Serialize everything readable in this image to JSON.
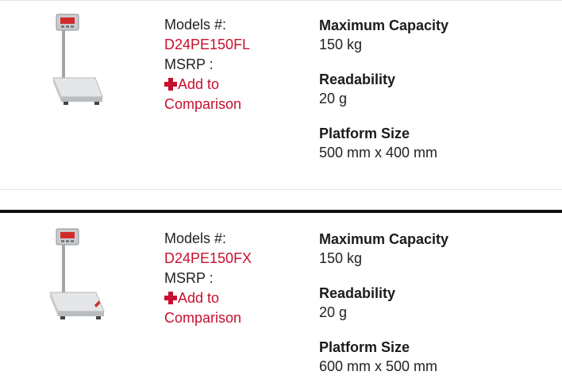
{
  "products": [
    {
      "models_label": "Models #:",
      "model_number": "D24PE150FL",
      "msrp_label": "MSRP :",
      "add_label": "Add to",
      "add_label_2": "Comparison",
      "image_icon": "floor-scale-icon",
      "specs": [
        {
          "label": "Maximum Capacity",
          "value": "150 kg"
        },
        {
          "label": "Readability",
          "value": "20 g"
        },
        {
          "label": "Platform Size",
          "value": "500 mm x 400 mm"
        }
      ]
    },
    {
      "models_label": "Models #:",
      "model_number": "D24PE150FX",
      "msrp_label": "MSRP :",
      "add_label": "Add to",
      "add_label_2": "Comparison",
      "image_icon": "floor-scale-icon",
      "specs": [
        {
          "label": "Maximum Capacity",
          "value": "150 kg"
        },
        {
          "label": "Readability",
          "value": "20 g"
        },
        {
          "label": "Platform Size",
          "value": "600 mm x 500 mm"
        }
      ]
    }
  ],
  "colors": {
    "accent": "#c8102e",
    "text": "#1b1b1b",
    "divider": "#111111"
  }
}
